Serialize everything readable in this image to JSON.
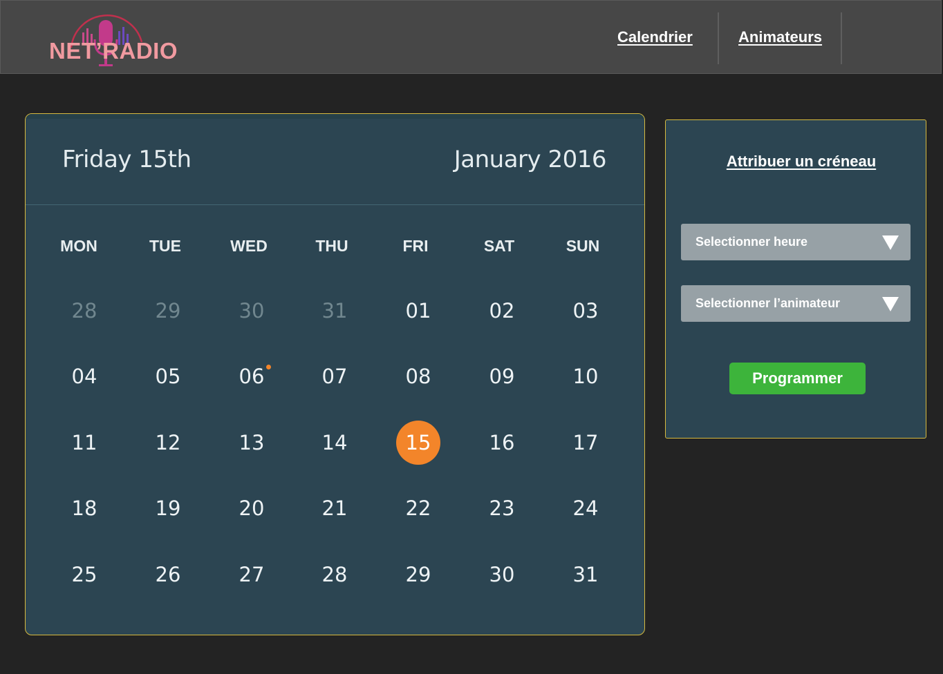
{
  "header": {
    "logo_text": "NET’RADIO",
    "nav": [
      {
        "label": "Calendrier"
      },
      {
        "label": "Animateurs"
      }
    ]
  },
  "calendar": {
    "selected_day_title": "Friday 15th",
    "month_title": "January 2016",
    "weekdays": [
      "MON",
      "TUE",
      "WED",
      "THU",
      "FRI",
      "SAT",
      "SUN"
    ],
    "weeks": [
      [
        "28",
        "29",
        "30",
        "31",
        "01",
        "02",
        "03"
      ],
      [
        "04",
        "05",
        "06",
        "07",
        "08",
        "09",
        "10"
      ],
      [
        "11",
        "12",
        "13",
        "14",
        "15",
        "16",
        "17"
      ],
      [
        "18",
        "19",
        "20",
        "21",
        "22",
        "23",
        "24"
      ],
      [
        "25",
        "26",
        "27",
        "28",
        "29",
        "30",
        "31"
      ]
    ],
    "selected_day": "15",
    "event_days": [
      "06"
    ],
    "outside_month_days": [
      "28",
      "29",
      "30",
      "31"
    ]
  },
  "panel": {
    "title": "Attribuer un créneau",
    "select_hour_label": "Selectionner heure",
    "select_host_label": "Selectionner l’animateur",
    "submit_label": "Programmer"
  },
  "colors": {
    "accent_orange": "#f3852a",
    "button_green": "#3db43b",
    "border_gold": "#d8bb3f",
    "card_bg": "#2c4552"
  }
}
